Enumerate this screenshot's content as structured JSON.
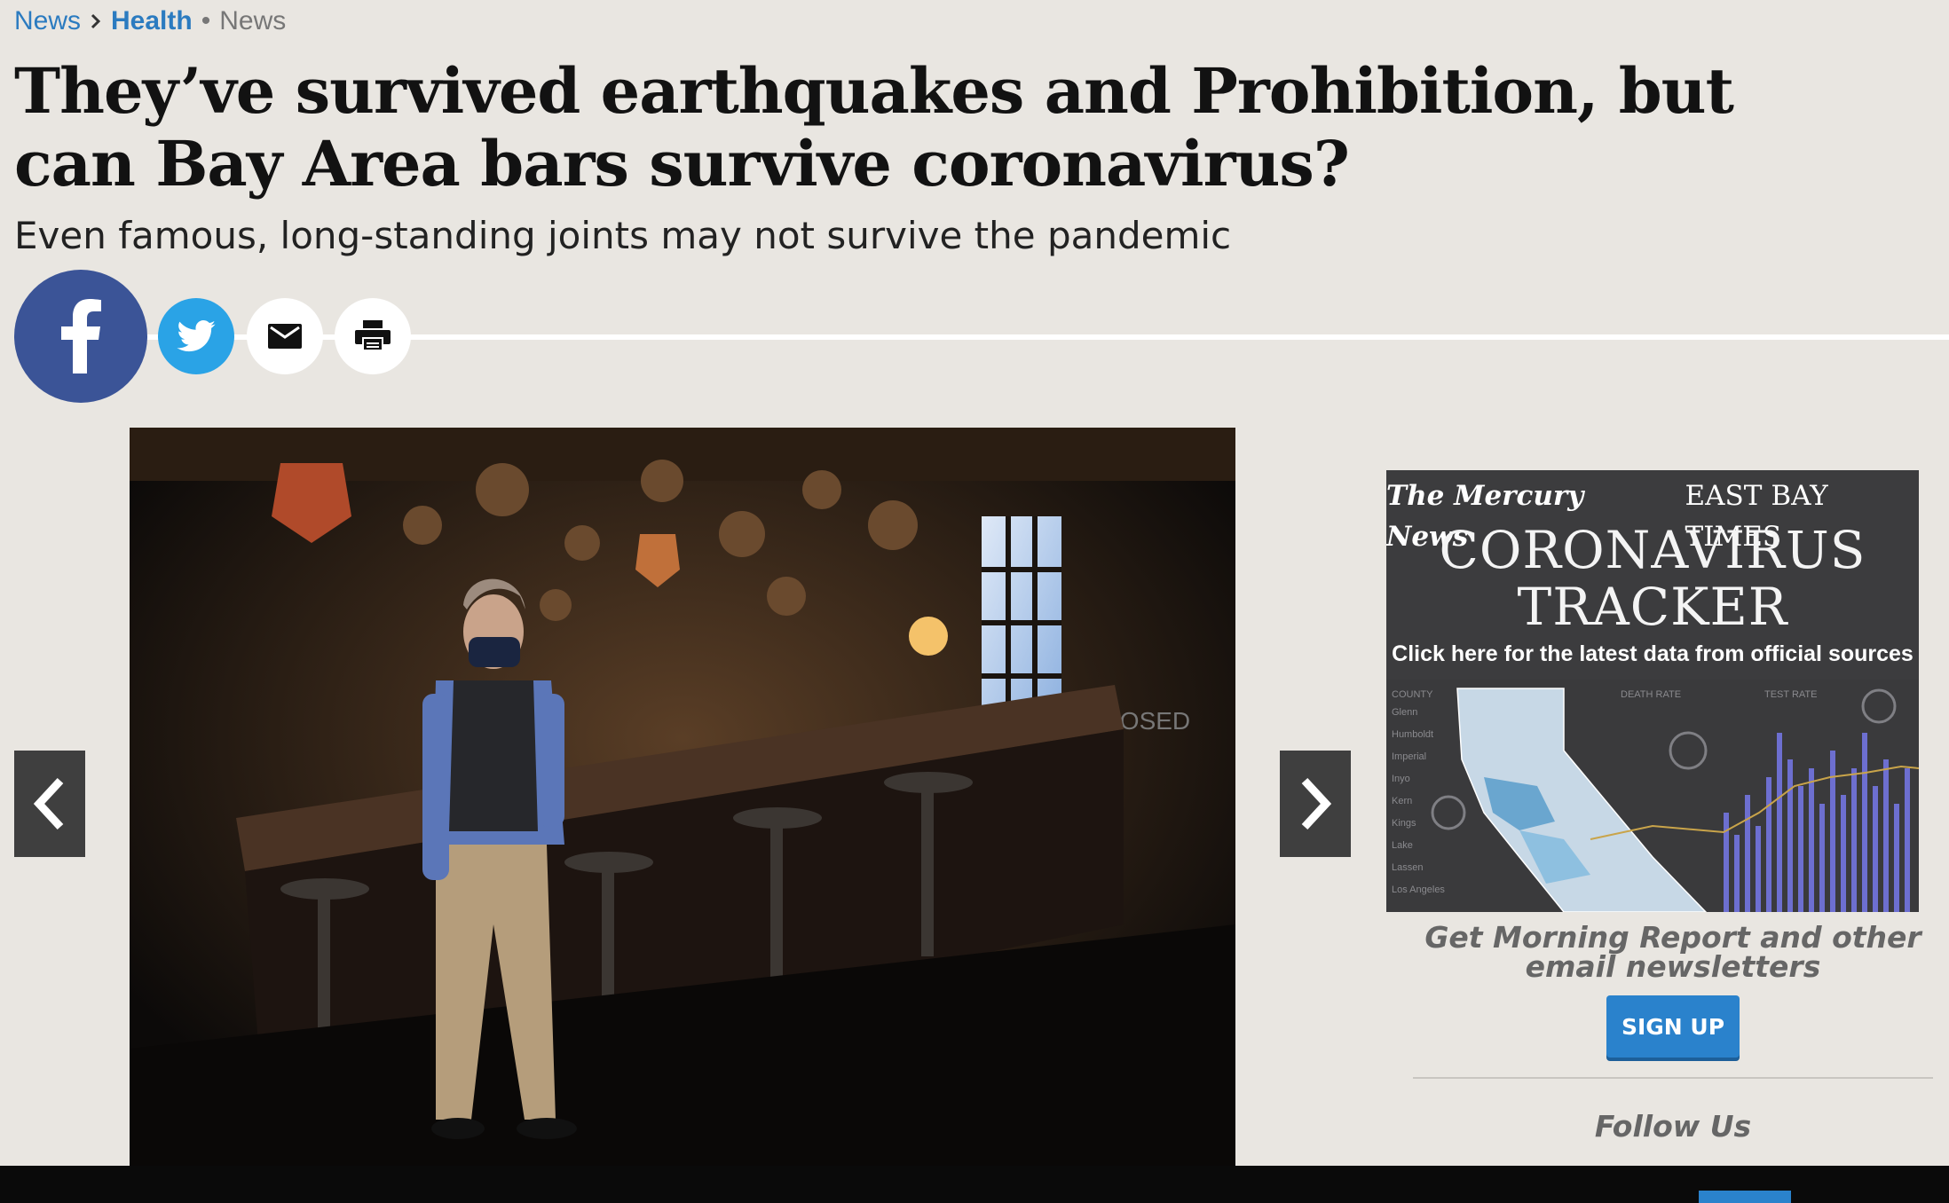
{
  "breadcrumb": {
    "root": "News",
    "section": "Health",
    "separator_dot": "•",
    "category": "News"
  },
  "article": {
    "headline": "They’ve survived earthquakes and Prohibition, but can Bay Area bars survive coronavirus?",
    "dek": "Even famous, long-standing joints may not survive the pandemic"
  },
  "share": {
    "facebook_icon": "facebook-icon",
    "twitter_icon": "twitter-icon",
    "email_icon": "email-icon",
    "print_icon": "print-icon",
    "colors": {
      "facebook": "#3b5497",
      "twitter": "#2aa3e6"
    }
  },
  "gallery": {
    "prev_icon": "chevron-left-icon",
    "next_icon": "chevron-right-icon",
    "sign_text": "CLOSED"
  },
  "tracker_ad": {
    "brand_one": "The Mercury News",
    "brand_two": "EAST BAY TIMES",
    "title_line1": "CORONAVIRUS",
    "title_line2": "TRACKER",
    "subtitle": "Click here for the latest data from official sources",
    "columns": [
      "COUNTY",
      "DEATH RATE",
      "TEST RATE"
    ],
    "counties": [
      "Glenn",
      "Humboldt",
      "Imperial",
      "Inyo",
      "Kern",
      "Kings",
      "Lake",
      "Lassen",
      "Los Angeles"
    ]
  },
  "sidebar": {
    "newsletter_text": "Get Morning Report and other email newsletters",
    "signup_label": "SIGN UP",
    "follow_label": "Follow Us",
    "accent_color": "#2a82cc"
  }
}
